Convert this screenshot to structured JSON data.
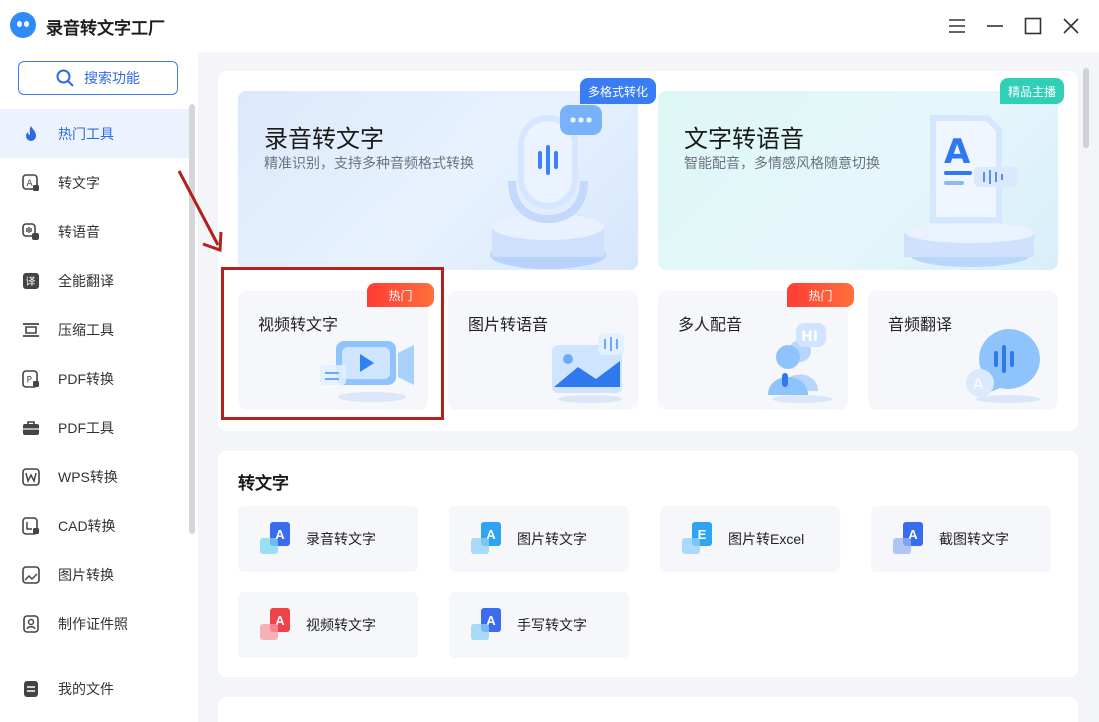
{
  "window": {
    "title": "录音转文字工厂"
  },
  "sidebar": {
    "search_label": "搜索功能",
    "items": [
      {
        "label": "热门工具",
        "icon": "fire-icon",
        "active": true
      },
      {
        "label": "转文字",
        "icon": "text-convert-icon"
      },
      {
        "label": "转语音",
        "icon": "voice-icon"
      },
      {
        "label": "全能翻译",
        "icon": "translate-icon"
      },
      {
        "label": "压缩工具",
        "icon": "compress-icon"
      },
      {
        "label": "PDF转换",
        "icon": "pdf-convert-icon"
      },
      {
        "label": "PDF工具",
        "icon": "toolbox-icon"
      },
      {
        "label": "WPS转换",
        "icon": "wps-icon"
      },
      {
        "label": "CAD转换",
        "icon": "cad-icon"
      },
      {
        "label": "图片转换",
        "icon": "image-icon"
      },
      {
        "label": "制作证件照",
        "icon": "id-photo-icon"
      }
    ],
    "bottom_item": {
      "label": "我的文件",
      "icon": "file-icon"
    }
  },
  "hot": {
    "banners": [
      {
        "title": "录音转文字",
        "subtitle": "精准识别，支持多种音频格式转换",
        "tag": "多格式转化"
      },
      {
        "title": "文字转语音",
        "subtitle": "智能配音，多情感风格随意切换",
        "tag": "精品主播"
      }
    ],
    "tiles": [
      {
        "title": "视频转文字",
        "tag": "热门"
      },
      {
        "title": "图片转语音"
      },
      {
        "title": "多人配音",
        "tag": "热门"
      },
      {
        "title": "音频翻译"
      }
    ]
  },
  "convert": {
    "title": "转文字",
    "tools": [
      {
        "label": "录音转文字",
        "letter": "A",
        "color": "#3a6cf0"
      },
      {
        "label": "图片转文字",
        "letter": "A",
        "color": "#2ea4f3"
      },
      {
        "label": "图片转Excel",
        "letter": "E",
        "color": "#2ea4f3"
      },
      {
        "label": "截图转文字",
        "letter": "A",
        "color": "#3a6cf0"
      },
      {
        "label": "视频转文字",
        "letter": "A",
        "color": "#f0424a"
      },
      {
        "label": "手写转文字",
        "letter": "A",
        "color": "#3a6cf0"
      }
    ]
  },
  "colors": {
    "accent": "#2d6be4",
    "hot": "#ff3c35",
    "highlight": "#b4201c"
  }
}
